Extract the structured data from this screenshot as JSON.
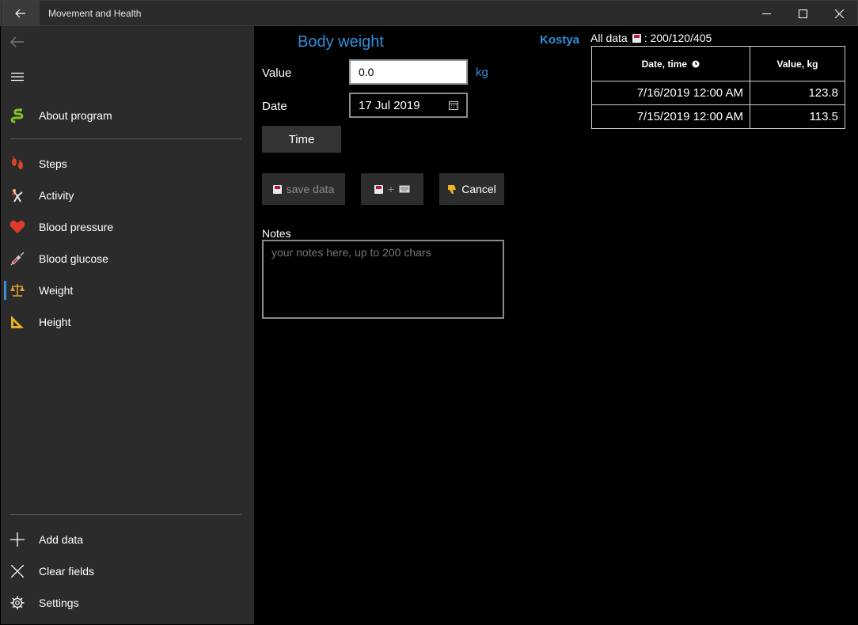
{
  "window": {
    "title": "Movement and Health"
  },
  "sidebar": {
    "top": [
      {
        "label": "About program",
        "icon": "snake-icon"
      }
    ],
    "items": [
      {
        "label": "Steps",
        "icon": "footprints-icon"
      },
      {
        "label": "Activity",
        "icon": "gymnast-icon"
      },
      {
        "label": "Blood pressure",
        "icon": "heart-icon"
      },
      {
        "label": "Blood glucose",
        "icon": "syringe-icon"
      },
      {
        "label": "Weight",
        "icon": "scales-icon",
        "selected": true
      },
      {
        "label": "Height",
        "icon": "triangular-ruler-icon"
      }
    ],
    "bottom": [
      {
        "label": "Add data",
        "icon": "plus-icon"
      },
      {
        "label": "Clear fields",
        "icon": "close-icon"
      },
      {
        "label": "Settings",
        "icon": "gear-icon"
      }
    ]
  },
  "main": {
    "title": "Body weight",
    "value_label": "Value",
    "value": "0.0",
    "unit": "kg",
    "date_label": "Date",
    "date": "17 Jul 2019",
    "time_button": "Time",
    "save_button": "save data",
    "save_plus_symbol": "+",
    "cancel_button": "Cancel",
    "notes_label": "Notes",
    "notes_placeholder": "your notes here, up to 200 chars",
    "user": "Kostya",
    "all_data_label": "All data",
    "all_data_counts": ": 200/120/405"
  },
  "table": {
    "headers": [
      "Date, time",
      "Value, kg"
    ],
    "rows": [
      [
        "7/16/2019 12:00 AM",
        "123.8"
      ],
      [
        "7/15/2019 12:00 AM",
        "113.5"
      ]
    ]
  },
  "colors": {
    "accent": "#2f8fd8",
    "sidebar_bg": "#2b2b2b",
    "main_bg": "#000000"
  }
}
